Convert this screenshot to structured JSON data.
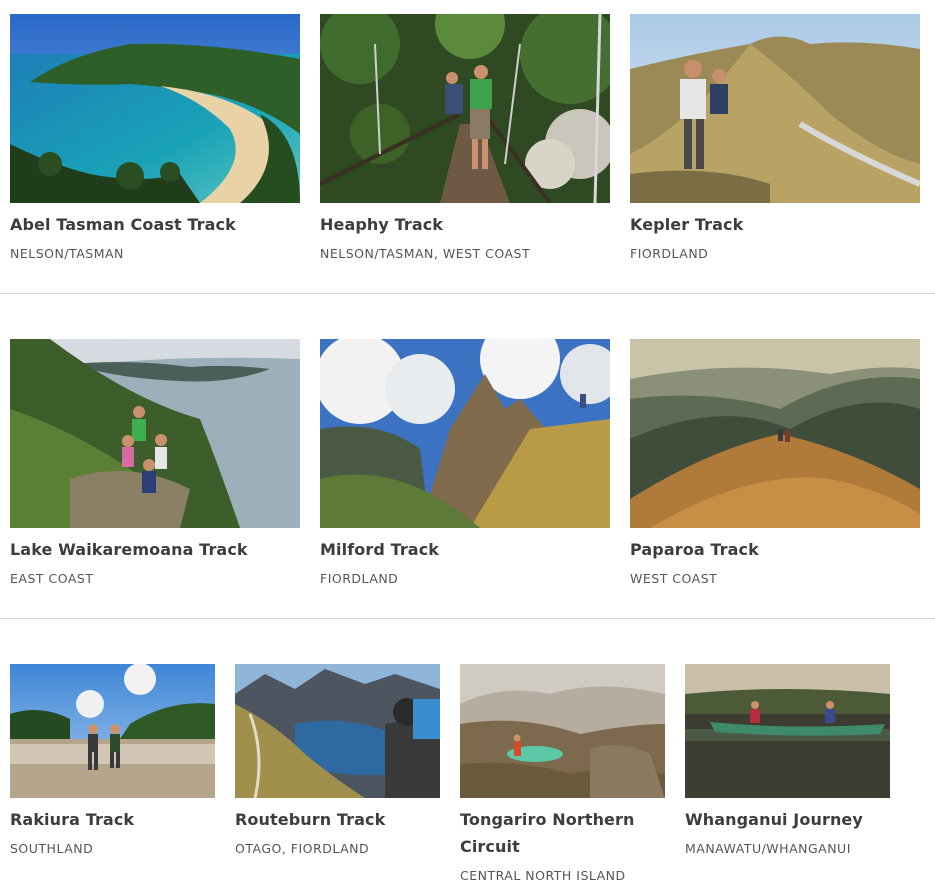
{
  "tracks": [
    {
      "title": "Abel Tasman Coast Track",
      "region": "NELSON/TASMAN",
      "image": "coastal-beach-bay-photo"
    },
    {
      "title": "Heaphy Track",
      "region": "NELSON/TASMAN, WEST COAST",
      "image": "swing-bridge-trampers-photo"
    },
    {
      "title": "Kepler Track",
      "region": "FIORDLAND",
      "image": "alpine-ridge-trampers-photo"
    },
    {
      "title": "Lake Waikaremoana Track",
      "region": "EAST COAST",
      "image": "lake-lookout-trampers-photo"
    },
    {
      "title": "Milford Track",
      "region": "FIORDLAND",
      "image": "mountain-peak-tussock-photo"
    },
    {
      "title": "Paparoa Track",
      "region": "WEST COAST",
      "image": "ridge-hills-tussock-photo"
    },
    {
      "title": "Rakiura Track",
      "region": "SOUTHLAND",
      "image": "tidal-beach-trampers-photo"
    },
    {
      "title": "Routeburn Track",
      "region": "OTAGO, FIORDLAND",
      "image": "alpine-lake-tramper-photo"
    },
    {
      "title": "Tongariro Northern Circuit",
      "region": "CENTRAL NORTH ISLAND",
      "image": "volcanic-emerald-lakes-photo"
    },
    {
      "title": "Whanganui Journey",
      "region": "MANAWATU/WHANGANUI",
      "image": "river-canoe-photo"
    }
  ]
}
